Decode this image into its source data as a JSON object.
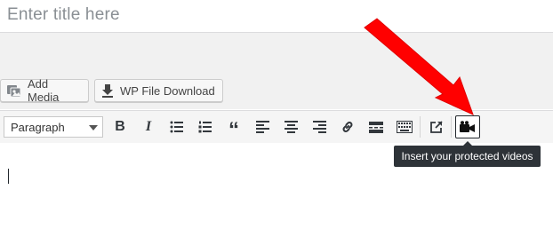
{
  "title": {
    "placeholder": "Enter title here"
  },
  "media_buttons": {
    "add_media": "Add Media",
    "wp_file_download": "WP File Download"
  },
  "toolbar": {
    "format_select": "Paragraph",
    "buttons": [
      "bold-icon",
      "italic-icon",
      "bullet-list-icon",
      "numbered-list-icon",
      "blockquote-icon",
      "align-left-icon",
      "align-center-icon",
      "align-right-icon",
      "link-icon",
      "read-more-icon",
      "toolbar-toggle-icon",
      "external-link-icon",
      "video-camera-icon"
    ]
  },
  "tooltip": {
    "text": "Insert your protected videos"
  },
  "annotation": {
    "arrow_color": "#ff0000"
  },
  "colors": {
    "toolbar_bg": "#f5f5f5",
    "media_bg": "#f1f1f1",
    "tooltip_bg": "#2e3338"
  }
}
